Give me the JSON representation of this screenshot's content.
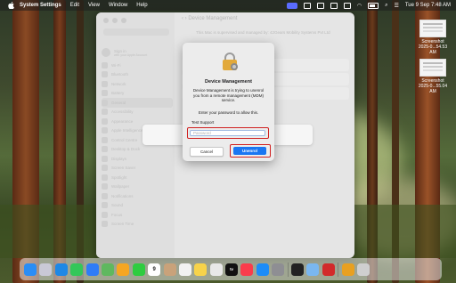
{
  "menubar": {
    "app_name": "System Settings",
    "items": [
      "Edit",
      "View",
      "Window",
      "Help"
    ],
    "datetime": "Tue 9 Sep  7:48 AM"
  },
  "desktop": {
    "files": [
      {
        "name1": "Screenshot",
        "name2": "2025-0...54.53 AM"
      },
      {
        "name1": "Screenshot",
        "name2": "2025-0...55.04 AM"
      }
    ]
  },
  "window": {
    "title": "Device Management",
    "info": "This Mac is supervised and managed by: 42Gears Mobility Systems Pvt Ltd",
    "account": {
      "name": "Sign in",
      "sub": "with your Apple Account"
    },
    "sidebar_items": [
      "Wi-Fi",
      "Bluetooth",
      "Network",
      "Battery",
      "General",
      "Accessibility",
      "Appearance",
      "Apple Intelligence & Siri",
      "Control Centre",
      "Desktop & Dock",
      "Displays",
      "Screen Saver",
      "Spotlight",
      "Wallpaper",
      "Notifications",
      "Sound",
      "Focus",
      "Screen Time"
    ],
    "selected_index": 4
  },
  "dialog": {
    "title": "Device Management",
    "message": "Device Management is trying to unenrol you from a remote management (MDM) service.",
    "prompt": "Enter your password to allow this.",
    "username": "Test Support",
    "password_placeholder": "Password",
    "cancel_label": "Cancel",
    "unenrol_label": "Unenrol"
  },
  "dock": {
    "icons": [
      {
        "name": "finder-icon",
        "color": "#2a8df5"
      },
      {
        "name": "launchpad-icon",
        "color": "#c9c9d6"
      },
      {
        "name": "safari-icon",
        "color": "#1e88e5"
      },
      {
        "name": "messages-icon",
        "color": "#34c759"
      },
      {
        "name": "mail-icon",
        "color": "#2f7cf6"
      },
      {
        "name": "maps-icon",
        "color": "#5fb85f"
      },
      {
        "name": "photos-icon",
        "color": "#f5a623"
      },
      {
        "name": "facetime-icon",
        "color": "#2ecc40"
      },
      {
        "name": "calendar-icon",
        "color": "#ffffff"
      },
      {
        "name": "contacts-icon",
        "color": "#c9a27a"
      },
      {
        "name": "reminders-icon",
        "color": "#f2f2f2"
      },
      {
        "name": "notes-icon",
        "color": "#f7d34a"
      },
      {
        "name": "freeform-icon",
        "color": "#e8e8e8"
      },
      {
        "name": "tv-icon",
        "color": "#111111"
      },
      {
        "name": "music-icon",
        "color": "#fa3c4c"
      },
      {
        "name": "app-store-icon",
        "color": "#1d8cf8"
      },
      {
        "name": "system-settings-icon",
        "color": "#8e8e93"
      },
      {
        "name": "activity-monitor-icon",
        "color": "#222222"
      },
      {
        "name": "preview-icon",
        "color": "#7ab7f0"
      },
      {
        "name": "app-red-icon",
        "color": "#d22a2a"
      },
      {
        "name": "archive-icon",
        "color": "#e8a020"
      },
      {
        "name": "trash-icon",
        "color": "#cfcfcf"
      }
    ],
    "calendar_day": "9",
    "tv_label": "tv"
  }
}
